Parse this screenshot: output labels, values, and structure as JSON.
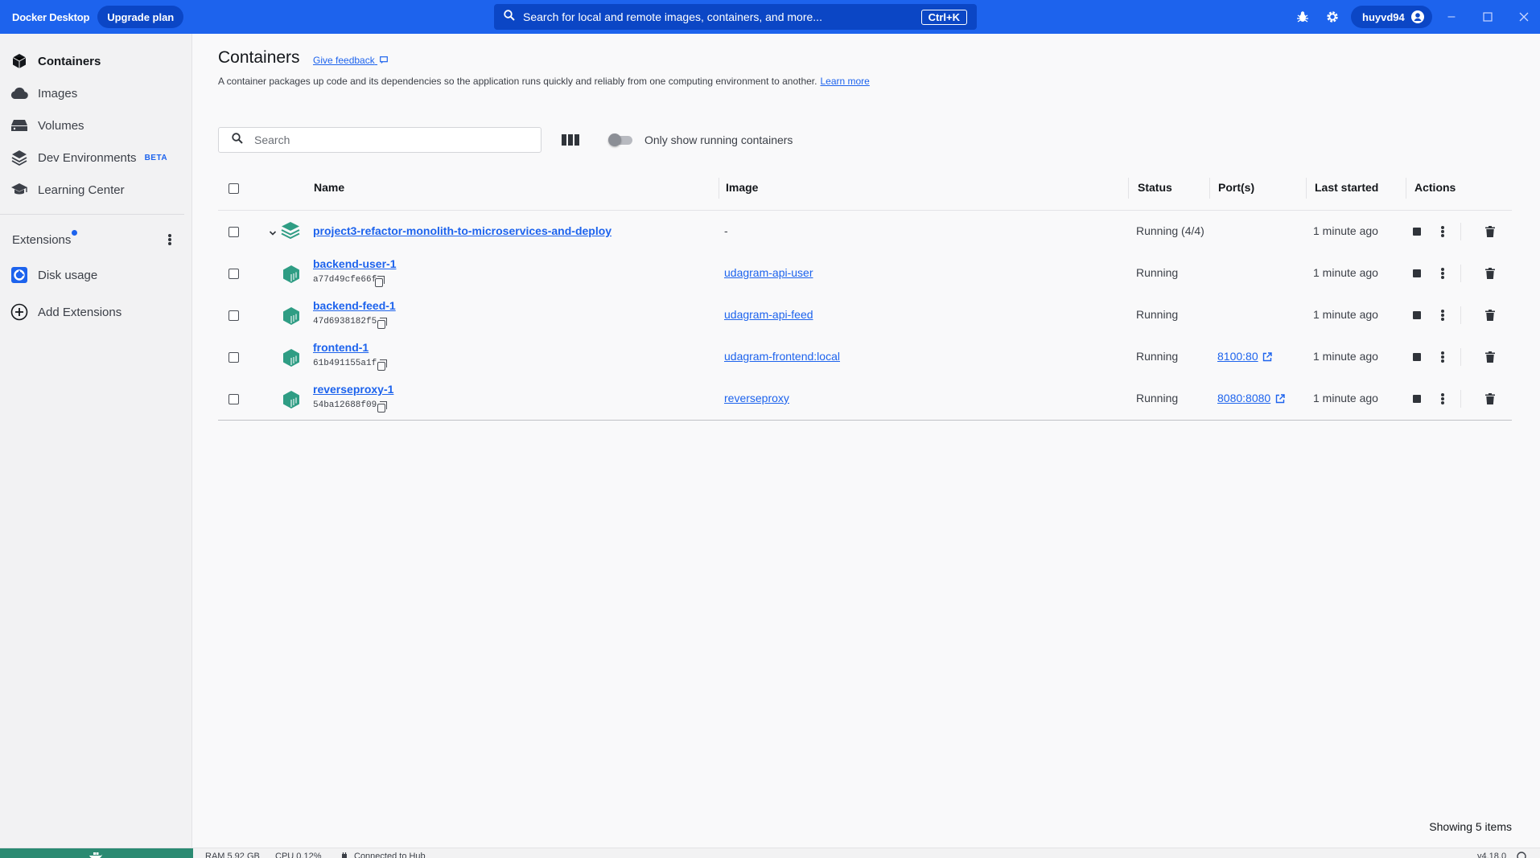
{
  "titlebar": {
    "brand": "Docker Desktop",
    "upgrade_label": "Upgrade plan",
    "search_text": "Search for local and remote images, containers, and more...",
    "shortcut": "Ctrl+K",
    "username": "huyvd94"
  },
  "sidebar": {
    "items": [
      {
        "label": "Containers",
        "icon": "container-icon",
        "active": true
      },
      {
        "label": "Images",
        "icon": "cloud-icon"
      },
      {
        "label": "Volumes",
        "icon": "hard-drive-icon"
      },
      {
        "label": "Dev Environments",
        "icon": "stack-icon",
        "badge": "BETA"
      },
      {
        "label": "Learning Center",
        "icon": "graduation-cap-icon"
      }
    ],
    "extensions_label": "Extensions",
    "extensions": [
      {
        "label": "Disk usage",
        "icon": "disk-usage-icon"
      },
      {
        "label": "Add Extensions",
        "icon": "add-circle-icon"
      }
    ]
  },
  "page": {
    "title": "Containers",
    "feedback": "Give feedback",
    "description": "A container packages up code and its dependencies so the application runs quickly and reliably from one computing environment to another.",
    "learn_more": "Learn more"
  },
  "toolbar": {
    "search_placeholder": "Search",
    "toggle_label": "Only show running containers",
    "toggle_on": false
  },
  "table": {
    "headers": {
      "name": "Name",
      "image": "Image",
      "status": "Status",
      "ports": "Port(s)",
      "last_started": "Last started",
      "actions": "Actions"
    },
    "group": {
      "name": "project3-refactor-monolith-to-microservices-and-deploy",
      "image": "-",
      "status": "Running (4/4)",
      "last_started": "1 minute ago"
    },
    "rows": [
      {
        "name": "backend-user-1",
        "id": "a77d49cfe66f",
        "image": "udagram-api-user",
        "status": "Running",
        "port": "",
        "last_started": "1 minute ago"
      },
      {
        "name": "backend-feed-1",
        "id": "47d6938182f5",
        "image": "udagram-api-feed",
        "status": "Running",
        "port": "",
        "last_started": "1 minute ago"
      },
      {
        "name": "frontend-1",
        "id": "61b491155a1f",
        "image": "udagram-frontend:local",
        "status": "Running",
        "port": "8100:80",
        "last_started": "1 minute ago"
      },
      {
        "name": "reverseproxy-1",
        "id": "54ba12688f09",
        "image": "reverseproxy",
        "status": "Running",
        "port": "8080:8080",
        "last_started": "1 minute ago"
      }
    ],
    "showing": "Showing 5 items"
  },
  "footer": {
    "ram": "RAM 5.92 GB",
    "cpu": "CPU 0.12%",
    "hub": "Connected to Hub",
    "version": "v4.18.0"
  },
  "colors": {
    "brand_blue": "#1d63ed",
    "engine_green": "#2b8a72",
    "container_teal": "#2f9d84"
  }
}
